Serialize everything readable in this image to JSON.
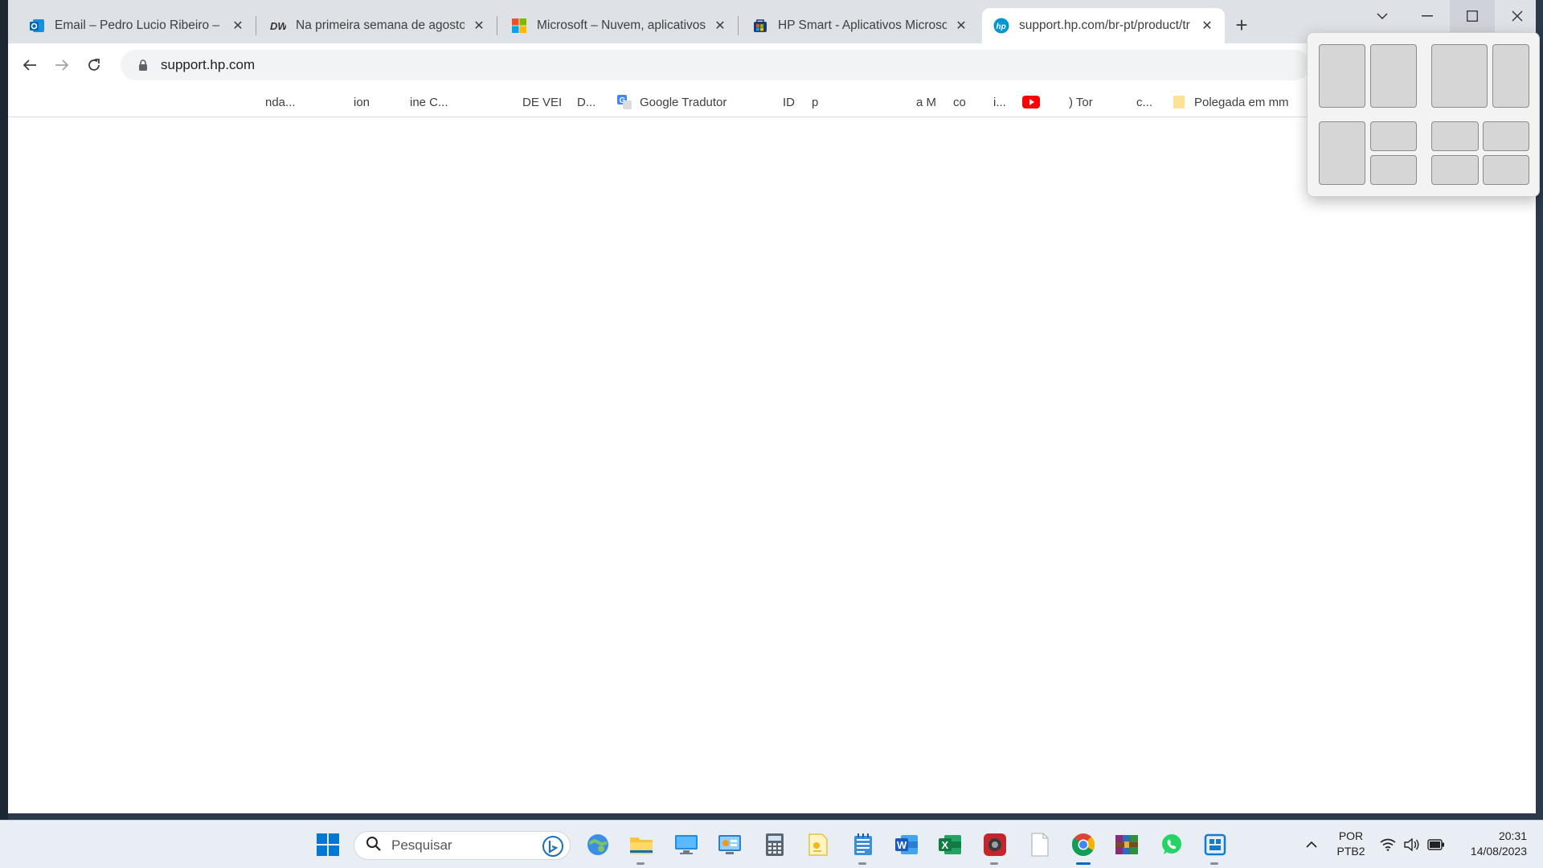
{
  "browser": {
    "tabs": [
      {
        "title": "Email – Pedro Lucio Ribeiro – Out",
        "favicon": "outlook-icon",
        "active": false
      },
      {
        "title": "Na primeira semana de agosto o",
        "favicon": "dw-icon",
        "active": false
      },
      {
        "title": "Microsoft – Nuvem, aplicativos e",
        "favicon": "microsoft-icon",
        "active": false
      },
      {
        "title": "HP Smart - Aplicativos Microsoft",
        "favicon": "ms-store-icon",
        "active": false
      },
      {
        "title": "support.hp.com/br-pt/product/tr",
        "favicon": "hp-icon",
        "active": true
      }
    ],
    "address_bar": {
      "url": "support.hp.com"
    },
    "bookmarks": [
      {
        "label": "nda..."
      },
      {
        "label": "ion"
      },
      {
        "label": "ine C..."
      },
      {
        "label": "DE VEI"
      },
      {
        "label": "D..."
      },
      {
        "label": "Google Tradutor",
        "icon": "google-translate-icon"
      },
      {
        "label": "ID"
      },
      {
        "label": "p"
      },
      {
        "label": "a M"
      },
      {
        "label": "co"
      },
      {
        "label": "i..."
      },
      {
        "label": ") Tor"
      },
      {
        "label": "c..."
      },
      {
        "label": "Polegada em mm",
        "icon": "bookmark-folder-icon"
      }
    ]
  },
  "snap_layouts": {
    "groups": 4
  },
  "taskbar": {
    "search_placeholder": "Pesquisar",
    "apps": [
      "start-icon",
      "bing-icon",
      "weather-icon",
      "file-explorer-icon",
      "remote-desktop-icon",
      "control-panel-icon",
      "calculator-icon",
      "sticky-notes-icon",
      "notepad-icon",
      "word-icon",
      "excel-icon",
      "camera-app-icon",
      "blank-file-icon",
      "chrome-icon",
      "winrar-icon",
      "whatsapp-icon",
      "network-app-icon"
    ],
    "tray": {
      "language_line1": "POR",
      "language_line2": "PTB2",
      "time": "20:31",
      "date": "14/08/2023"
    }
  },
  "colors": {
    "tabstrip": "#dee1e6",
    "taskbar": "#e9eef5",
    "accent": "#0067c0"
  }
}
